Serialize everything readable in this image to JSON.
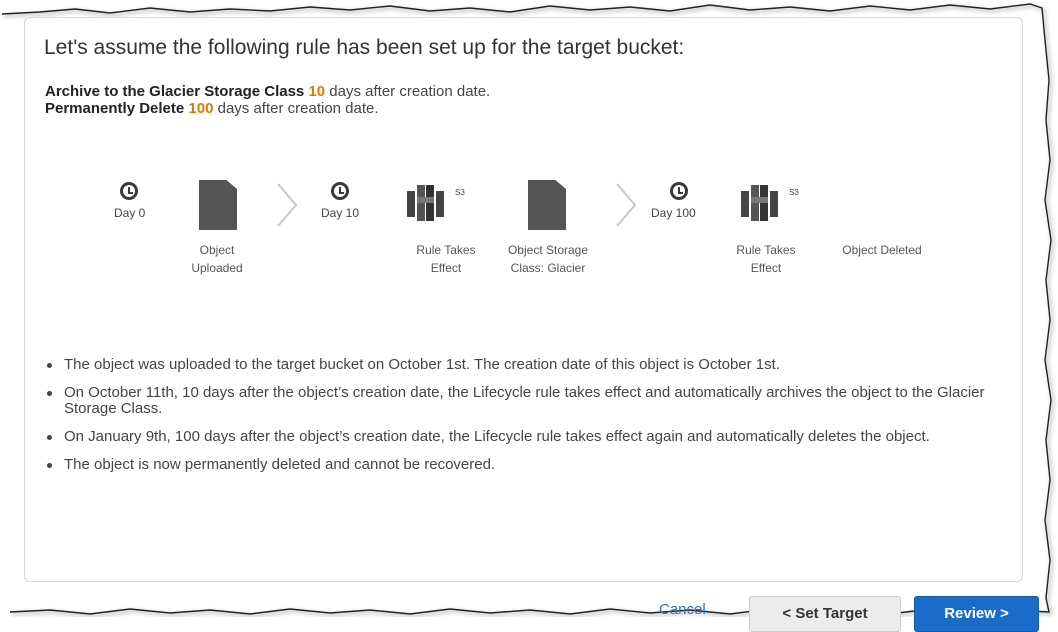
{
  "heading": "Let's assume the following rule has been set up for the target bucket:",
  "rule": {
    "archive_prefix": "Archive to the Glacier Storage Class",
    "archive_days": "10",
    "archive_suffix": " days after creation date.",
    "delete_prefix": "Permanently Delete",
    "delete_days": "100",
    "delete_suffix": " days after creation date."
  },
  "timeline": {
    "day0": "Day 0",
    "day10": "Day 10",
    "day100": "Day 100",
    "s3_label_1": "S3",
    "s3_label_2": "S3",
    "object_uploaded_l1": "Object",
    "object_uploaded_l2": "Uploaded",
    "rule_takes_effect_1_l1": "Rule Takes",
    "rule_takes_effect_1_l2": "Effect",
    "storage_class_l1": "Object Storage",
    "storage_class_l2": "Class: Glacier",
    "rule_takes_effect_2_l1": "Rule Takes",
    "rule_takes_effect_2_l2": "Effect",
    "object_deleted": "Object Deleted"
  },
  "bullets": [
    "The object was uploaded to the target bucket on October 1st. The creation date of this object is October 1st.",
    "On October 11th, 10 days after the object’s creation date, the Lifecycle rule takes effect and automatically archives the object to the Glacier Storage Class.",
    "On January 9th, 100 days after the object’s creation date, the Lifecycle rule takes effect again and automatically deletes the object.",
    "The object is now permanently deleted and cannot be recovered."
  ],
  "footer": {
    "cancel": "Cancel",
    "set_target": "< Set Target",
    "review": "Review >"
  },
  "colors": {
    "highlight": "#e07b00",
    "link": "#2f72b8",
    "primary_button": "#1a6cc8"
  }
}
